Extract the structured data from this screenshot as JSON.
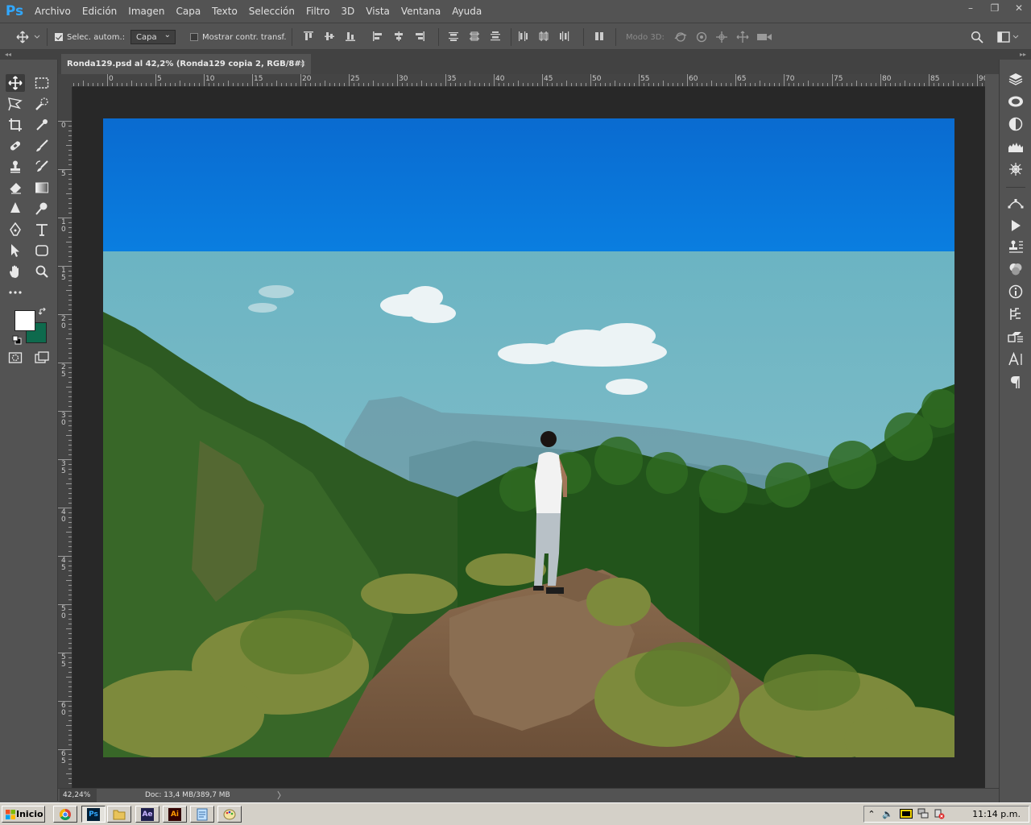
{
  "app": {
    "logo": "Ps"
  },
  "menu": [
    "Archivo",
    "Edición",
    "Imagen",
    "Capa",
    "Texto",
    "Selección",
    "Filtro",
    "3D",
    "Vista",
    "Ventana",
    "Ayuda"
  ],
  "window_controls": {
    "minimize": "–",
    "restore": "❐",
    "close": "✕"
  },
  "options": {
    "auto_select_label": "Selec. autom.:",
    "auto_select_checked": true,
    "auto_select_target": "Capa",
    "show_transform_label": "Mostrar contr. transf.",
    "show_transform_checked": false,
    "mode_3d_label": "Modo 3D:"
  },
  "document": {
    "tab_title": "Ronda129.psd al 42,2% (Ronda129 copia 2, RGB/8#) *",
    "close_glyph": "×"
  },
  "rulers": {
    "horizontal_labels": [
      "0",
      "5",
      "10",
      "15",
      "20",
      "25",
      "30",
      "35",
      "40",
      "45",
      "50",
      "55",
      "60",
      "65",
      "70",
      "75",
      "80",
      "85",
      "90"
    ],
    "vertical_labels": [
      "0",
      "5",
      "1\n0",
      "1\n5",
      "2\n0",
      "2\n5",
      "3\n0",
      "3\n5",
      "4\n0",
      "4\n5",
      "5\n0",
      "5\n5",
      "6\n0",
      "6\n5"
    ]
  },
  "status": {
    "zoom": "42,24%",
    "doc_info": "Doc: 13,4 MB/389,7 MB",
    "arrow": "〉"
  },
  "tools": [
    "move-tool",
    "marquee-tool",
    "lasso-tool",
    "quick-select-tool",
    "crop-tool",
    "eyedropper-tool",
    "healing-tool",
    "brush-tool",
    "stamp-tool",
    "history-brush-tool",
    "eraser-tool",
    "gradient-tool",
    "blur-tool",
    "dodge-tool",
    "pen-tool",
    "type-tool",
    "path-select-tool",
    "shape-tool",
    "hand-tool",
    "zoom-tool",
    "more-tools"
  ],
  "colors": {
    "foreground": "#ffffff",
    "background": "#0e6a4d",
    "app_bg": "#535353",
    "canvas_bg": "#282828",
    "accent": "#31a8ff"
  },
  "panel_icons": [
    "layers-icon",
    "libraries-icon",
    "adjustments-icon",
    "histogram-icon",
    "navigator-icon",
    "paths-icon",
    "actions-icon",
    "clone-source-icon",
    "color-icon",
    "info-icon",
    "history-icon",
    "properties-icon",
    "character-icon",
    "paragraph-icon"
  ],
  "taskbar": {
    "start_label": "Inicio",
    "apps": [
      "chrome",
      "photoshop",
      "explorer",
      "after-effects",
      "illustrator",
      "notepad",
      "paint"
    ],
    "ae_label": "Ae",
    "ai_label": "Ai",
    "ps_label": "Ps",
    "clock": "11:14 p.m."
  }
}
